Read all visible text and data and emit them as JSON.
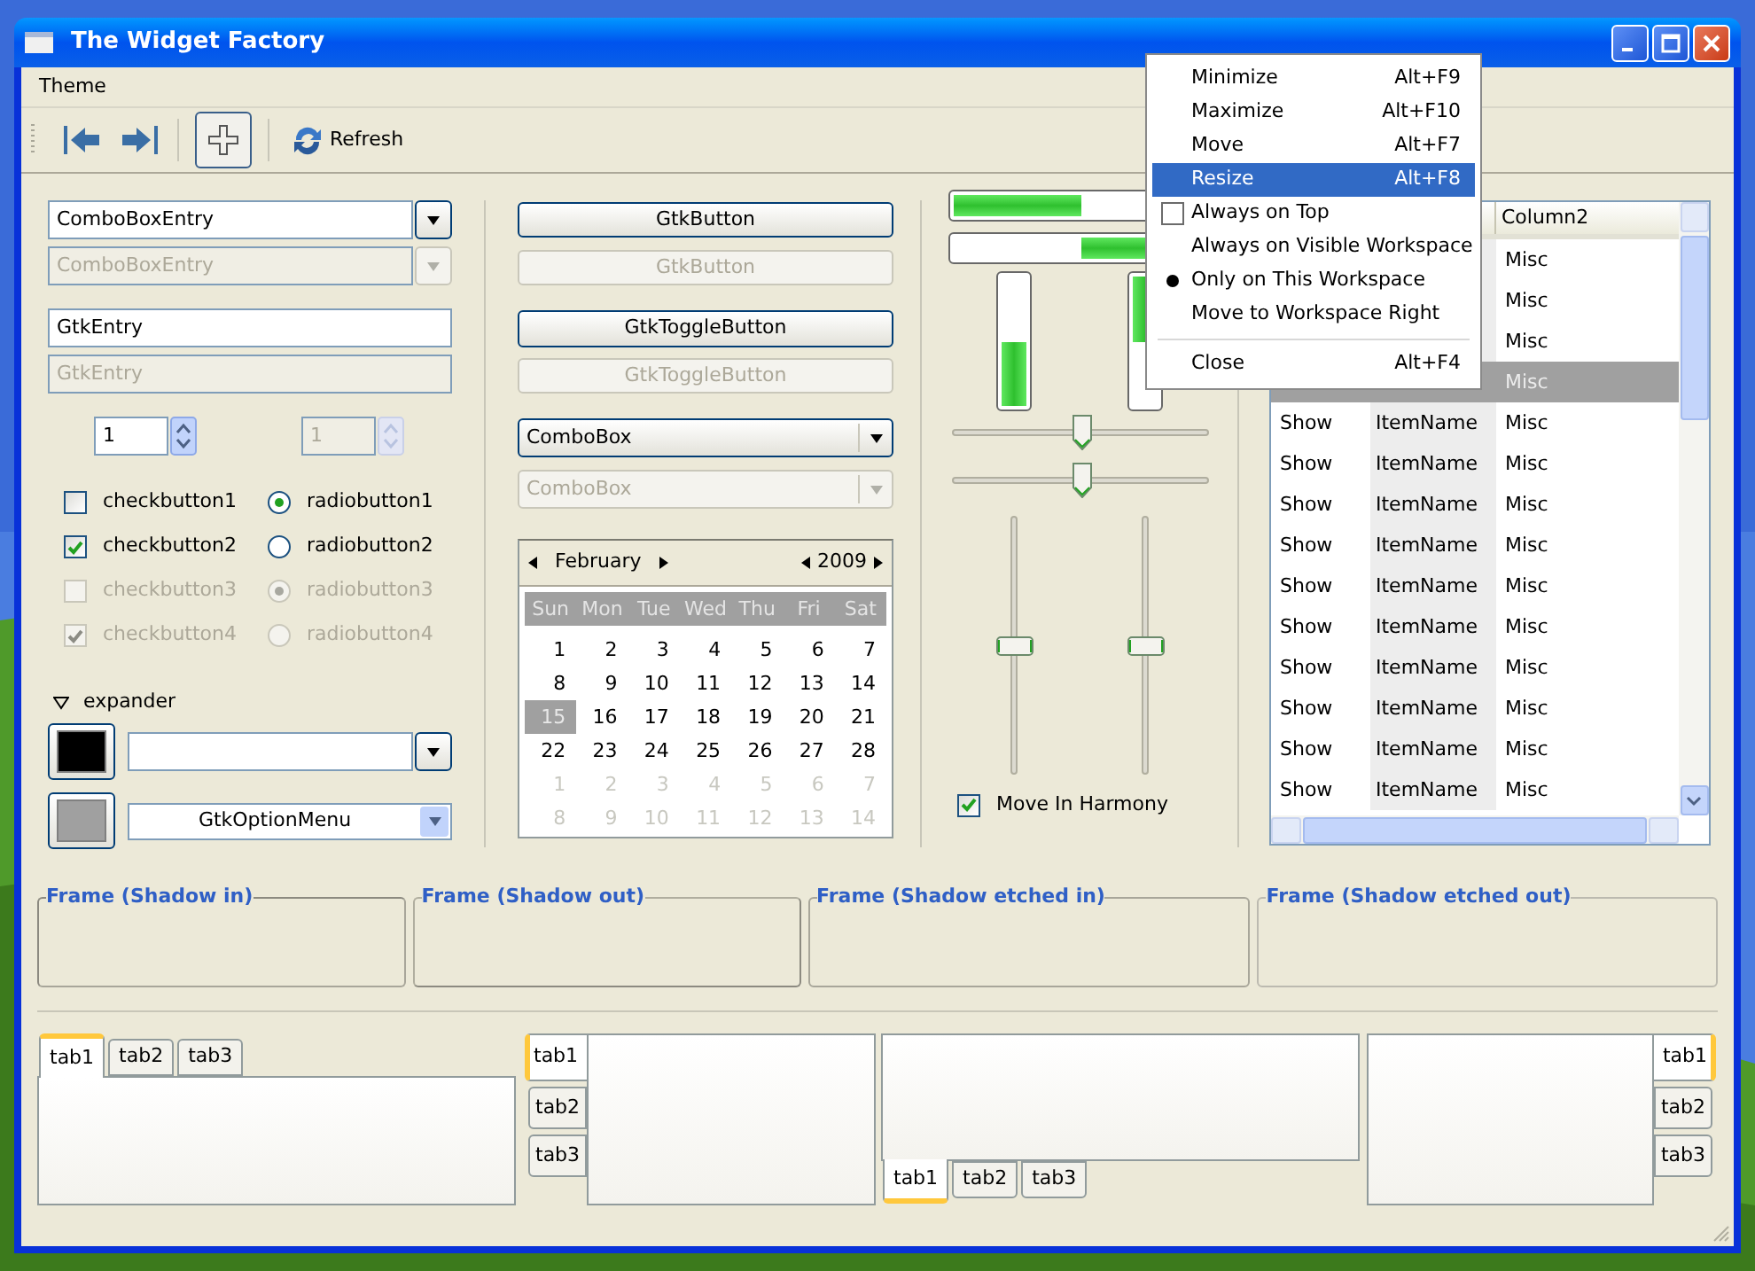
{
  "window": {
    "title": "The Widget Factory"
  },
  "menu_bar": [
    "Theme"
  ],
  "toolbar": {
    "toggle_pressed": true,
    "refresh": "Refresh"
  },
  "left": {
    "combo_entries": [
      {
        "value": "ComboBoxEntry",
        "disabled": false
      },
      {
        "value": "ComboBoxEntry",
        "disabled": true
      }
    ],
    "entries": [
      {
        "value": "GtkEntry",
        "disabled": false
      },
      {
        "value": "GtkEntry",
        "disabled": true
      }
    ],
    "spin_buttons": [
      {
        "value": "1",
        "disabled": false
      },
      {
        "value": "1",
        "disabled": true
      }
    ],
    "check_buttons": [
      {
        "label": "checkbutton1",
        "checked": false,
        "disabled": false
      },
      {
        "label": "checkbutton2",
        "checked": true,
        "disabled": false
      },
      {
        "label": "checkbutton3",
        "checked": false,
        "disabled": true
      },
      {
        "label": "checkbutton4",
        "checked": true,
        "disabled": true
      }
    ],
    "radio_buttons": [
      {
        "label": "radiobutton1",
        "selected": true,
        "disabled": false
      },
      {
        "label": "radiobutton2",
        "selected": false,
        "disabled": false
      },
      {
        "label": "radiobutton3",
        "selected": true,
        "disabled": true
      },
      {
        "label": "radiobutton4",
        "selected": false,
        "disabled": true
      }
    ],
    "expander": {
      "label": "expander",
      "expanded": true
    },
    "color_rows": [
      {
        "kind": "combo_entry",
        "color": "#000000"
      },
      {
        "kind": "option_menu",
        "color": "#a0a0a0",
        "value": "GtkOptionMenu"
      }
    ]
  },
  "middle": {
    "buttons": [
      {
        "label": "GtkButton",
        "disabled": false
      },
      {
        "label": "GtkButton",
        "disabled": true
      }
    ],
    "toggle_buttons": [
      {
        "label": "GtkToggleButton",
        "disabled": false
      },
      {
        "label": "GtkToggleButton",
        "disabled": true
      }
    ],
    "combo_boxes": [
      {
        "value": "ComboBox",
        "disabled": false
      },
      {
        "value": "ComboBox",
        "disabled": true
      }
    ],
    "calendar": {
      "month": "February",
      "year": "2009",
      "weekdays": [
        "Sun",
        "Mon",
        "Tue",
        "Wed",
        "Thu",
        "Fri",
        "Sat"
      ],
      "days": [
        {
          "label": "1",
          "selected": false,
          "other_month": false
        },
        {
          "label": "2",
          "selected": false,
          "other_month": false
        },
        {
          "label": "3",
          "selected": false,
          "other_month": false
        },
        {
          "label": "4",
          "selected": false,
          "other_month": false
        },
        {
          "label": "5",
          "selected": false,
          "other_month": false
        },
        {
          "label": "6",
          "selected": false,
          "other_month": false
        },
        {
          "label": "7",
          "selected": false,
          "other_month": false
        },
        {
          "label": "8",
          "selected": false,
          "other_month": false
        },
        {
          "label": "9",
          "selected": false,
          "other_month": false
        },
        {
          "label": "10",
          "selected": false,
          "other_month": false
        },
        {
          "label": "11",
          "selected": false,
          "other_month": false
        },
        {
          "label": "12",
          "selected": false,
          "other_month": false
        },
        {
          "label": "13",
          "selected": false,
          "other_month": false
        },
        {
          "label": "14",
          "selected": false,
          "other_month": false
        },
        {
          "label": "15",
          "selected": true,
          "other_month": false
        },
        {
          "label": "16",
          "selected": false,
          "other_month": false
        },
        {
          "label": "17",
          "selected": false,
          "other_month": false
        },
        {
          "label": "18",
          "selected": false,
          "other_month": false
        },
        {
          "label": "19",
          "selected": false,
          "other_month": false
        },
        {
          "label": "20",
          "selected": false,
          "other_month": false
        },
        {
          "label": "21",
          "selected": false,
          "other_month": false
        },
        {
          "label": "22",
          "selected": false,
          "other_month": false
        },
        {
          "label": "23",
          "selected": false,
          "other_month": false
        },
        {
          "label": "24",
          "selected": false,
          "other_month": false
        },
        {
          "label": "25",
          "selected": false,
          "other_month": false
        },
        {
          "label": "26",
          "selected": false,
          "other_month": false
        },
        {
          "label": "27",
          "selected": false,
          "other_month": false
        },
        {
          "label": "28",
          "selected": false,
          "other_month": false
        },
        {
          "label": "1",
          "selected": false,
          "other_month": true
        },
        {
          "label": "2",
          "selected": false,
          "other_month": true
        },
        {
          "label": "3",
          "selected": false,
          "other_month": true
        },
        {
          "label": "4",
          "selected": false,
          "other_month": true
        },
        {
          "label": "5",
          "selected": false,
          "other_month": true
        },
        {
          "label": "6",
          "selected": false,
          "other_month": true
        },
        {
          "label": "7",
          "selected": false,
          "other_month": true
        },
        {
          "label": "8",
          "selected": false,
          "other_month": true
        },
        {
          "label": "9",
          "selected": false,
          "other_month": true
        },
        {
          "label": "10",
          "selected": false,
          "other_month": true
        },
        {
          "label": "11",
          "selected": false,
          "other_month": true
        },
        {
          "label": "12",
          "selected": false,
          "other_month": true
        },
        {
          "label": "13",
          "selected": false,
          "other_month": true
        },
        {
          "label": "14",
          "selected": false,
          "other_month": true
        }
      ]
    }
  },
  "right": {
    "progress_bars": [
      {
        "kind": "horizontal",
        "inverted": false,
        "level": 0.5
      },
      {
        "kind": "horizontal",
        "inverted": true,
        "level": 0.5
      },
      {
        "kind": "vertical",
        "inverted": false,
        "level": 0.5
      },
      {
        "kind": "vertical",
        "inverted": true,
        "level": 0.5
      }
    ],
    "scales": [
      {
        "kind": "horizontal",
        "level": 0.5
      },
      {
        "kind": "horizontal",
        "level": 0.5
      },
      {
        "kind": "vertical",
        "level": 0.5
      },
      {
        "kind": "vertical",
        "level": 0.5
      }
    ],
    "harmony": {
      "label": "Move In Harmony",
      "checked": true
    }
  },
  "tree": {
    "column_3_header": "Column2",
    "rows": [
      {
        "column_3": "Misc",
        "selected": false
      },
      {
        "column_3": "Misc",
        "selected": false
      },
      {
        "column_3": "Misc",
        "selected": false
      },
      {
        "column_3": "Misc",
        "selected": true
      },
      {
        "column_1": "Show",
        "column_2": "ItemName",
        "column_3": "Misc",
        "selected": false
      },
      {
        "column_1": "Show",
        "column_2": "ItemName",
        "column_3": "Misc",
        "selected": false
      },
      {
        "column_1": "Show",
        "column_2": "ItemName",
        "column_3": "Misc",
        "selected": false
      },
      {
        "column_1": "Show",
        "column_2": "ItemName",
        "column_3": "Misc",
        "selected": false
      },
      {
        "column_1": "Show",
        "column_2": "ItemName",
        "column_3": "Misc",
        "selected": false
      },
      {
        "column_1": "Show",
        "column_2": "ItemName",
        "column_3": "Misc",
        "selected": false
      },
      {
        "column_1": "Show",
        "column_2": "ItemName",
        "column_3": "Misc",
        "selected": false
      },
      {
        "column_1": "Show",
        "column_2": "ItemName",
        "column_3": "Misc",
        "selected": false
      },
      {
        "column_1": "Show",
        "column_2": "ItemName",
        "column_3": "Misc",
        "selected": false
      },
      {
        "column_1": "Show",
        "column_2": "ItemName",
        "column_3": "Misc",
        "selected": false
      }
    ]
  },
  "frames": [
    {
      "label": "Frame (Shadow in)",
      "kind": "in"
    },
    {
      "label": "Frame (Shadow out)",
      "kind": "out"
    },
    {
      "label": "Frame (Shadow etched in)",
      "kind": "etched_in"
    },
    {
      "label": "Frame (Shadow etched out)",
      "kind": "etched_out"
    }
  ],
  "notebooks": [
    {
      "kind": "top",
      "tabs": [
        {
          "label": "tab1",
          "selected": true
        },
        {
          "label": "tab2",
          "selected": false
        },
        {
          "label": "tab3",
          "selected": false
        }
      ]
    },
    {
      "kind": "left",
      "tabs": [
        {
          "label": "tab1",
          "selected": true
        },
        {
          "label": "tab2",
          "selected": false
        },
        {
          "label": "tab3",
          "selected": false
        }
      ]
    },
    {
      "kind": "bottom",
      "tabs": [
        {
          "label": "tab1",
          "selected": true
        },
        {
          "label": "tab2",
          "selected": false
        },
        {
          "label": "tab3",
          "selected": false
        }
      ]
    },
    {
      "kind": "right",
      "tabs": [
        {
          "label": "tab1",
          "selected": true
        },
        {
          "label": "tab2",
          "selected": false
        },
        {
          "label": "tab3",
          "selected": false
        }
      ]
    }
  ],
  "window_menu": [
    {
      "kind": "item",
      "label": "Minimize",
      "shortcut": "Alt+F9",
      "selected": false
    },
    {
      "kind": "item",
      "label": "Maximize",
      "shortcut": "Alt+F10",
      "selected": false
    },
    {
      "kind": "item",
      "label": "Move",
      "shortcut": "Alt+F7",
      "selected": false
    },
    {
      "kind": "item",
      "label": "Resize",
      "shortcut": "Alt+F8",
      "selected": true
    },
    {
      "kind": "check",
      "label": "Always on Top",
      "checked": false,
      "selected": false
    },
    {
      "kind": "item",
      "label": "Always on Visible Workspace",
      "selected": false
    },
    {
      "kind": "radio",
      "label": "Only on This Workspace",
      "checked": true,
      "selected": false
    },
    {
      "kind": "item",
      "label": "Move to Workspace Right",
      "selected": false
    },
    {
      "kind": "separator"
    },
    {
      "kind": "item",
      "label": "Close",
      "shortcut": "Alt+F4",
      "selected": false
    }
  ]
}
